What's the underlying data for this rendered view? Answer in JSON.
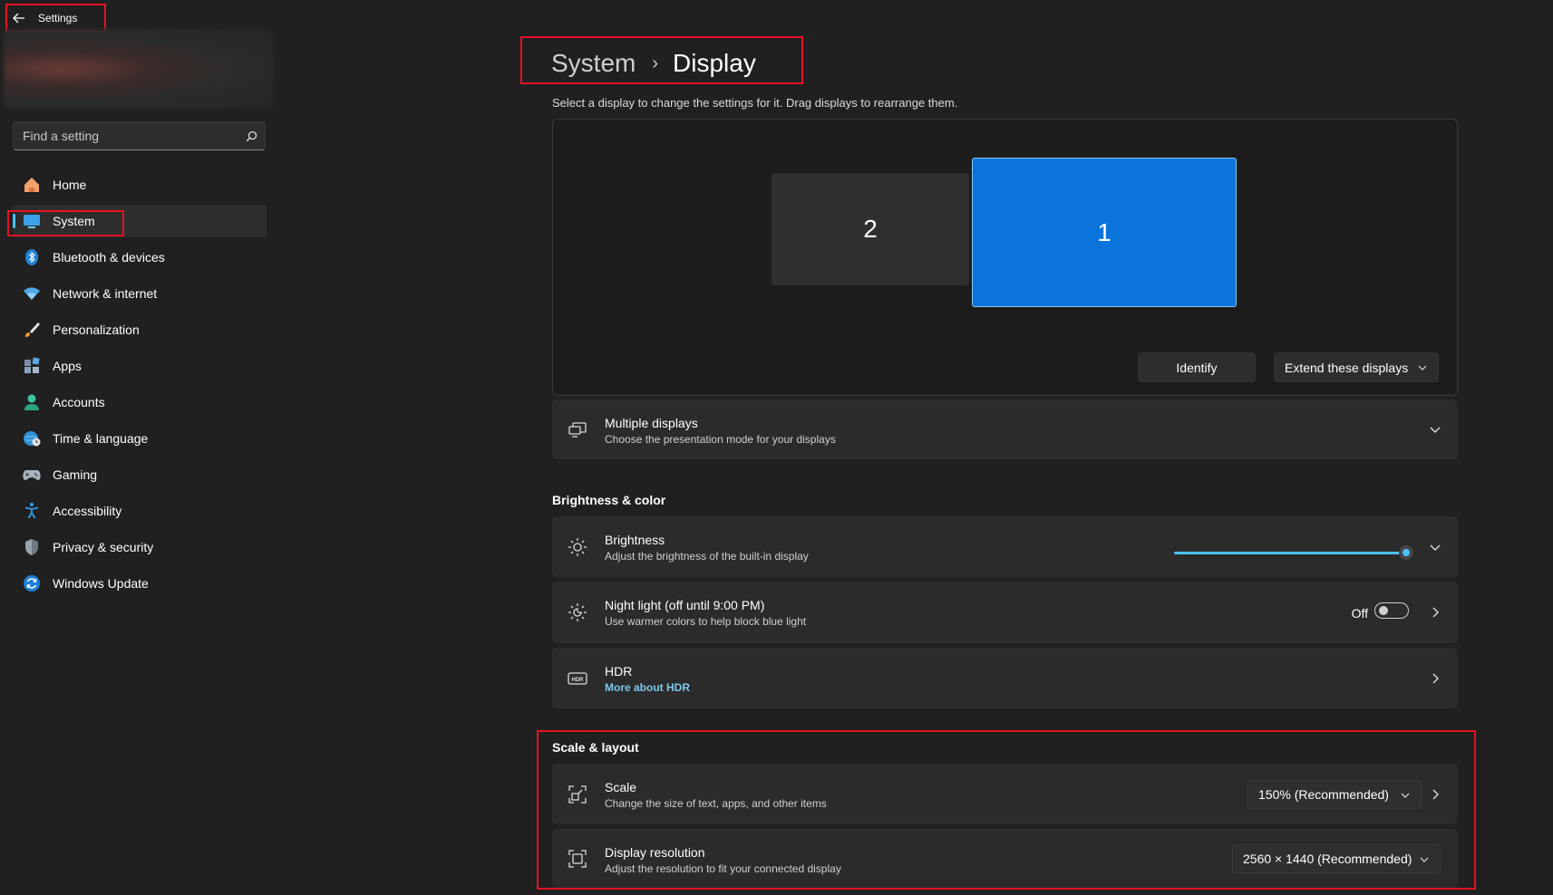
{
  "app": {
    "title": "Settings"
  },
  "search": {
    "placeholder": "Find a setting"
  },
  "sidebar": {
    "items": [
      {
        "label": "Home",
        "icon": "home-icon",
        "active": false
      },
      {
        "label": "System",
        "icon": "monitor-icon",
        "active": true
      },
      {
        "label": "Bluetooth & devices",
        "icon": "bluetooth-icon",
        "active": false
      },
      {
        "label": "Network & internet",
        "icon": "wifi-icon",
        "active": false
      },
      {
        "label": "Personalization",
        "icon": "brush-icon",
        "active": false
      },
      {
        "label": "Apps",
        "icon": "apps-icon",
        "active": false
      },
      {
        "label": "Accounts",
        "icon": "person-icon",
        "active": false
      },
      {
        "label": "Time & language",
        "icon": "globe-clock-icon",
        "active": false
      },
      {
        "label": "Gaming",
        "icon": "gamepad-icon",
        "active": false
      },
      {
        "label": "Accessibility",
        "icon": "accessibility-icon",
        "active": false
      },
      {
        "label": "Privacy & security",
        "icon": "shield-icon",
        "active": false
      },
      {
        "label": "Windows Update",
        "icon": "refresh-icon",
        "active": false
      }
    ]
  },
  "header": {
    "crumb_parent": "System",
    "crumb_separator": "›",
    "crumb_current": "Display",
    "subtitle": "Select a display to change the settings for it. Drag displays to rearrange them."
  },
  "arrangement": {
    "monitor_2": "2",
    "monitor_1": "1",
    "identify_label": "Identify",
    "mode_value": "Extend these displays"
  },
  "multiple_displays": {
    "title": "Multiple displays",
    "subtitle": "Choose the presentation mode for your displays"
  },
  "brightness_color": {
    "heading": "Brightness & color",
    "brightness": {
      "title": "Brightness",
      "subtitle": "Adjust the brightness of the built-in display",
      "value": 100
    },
    "night_light": {
      "title": "Night light (off until 9:00 PM)",
      "subtitle": "Use warmer colors to help block blue light",
      "state": "Off"
    },
    "hdr": {
      "title": "HDR",
      "link": "More about HDR"
    }
  },
  "scale_layout": {
    "heading": "Scale & layout",
    "scale": {
      "title": "Scale",
      "subtitle": "Change the size of text, apps, and other items",
      "value": "150% (Recommended)"
    },
    "resolution": {
      "title": "Display resolution",
      "subtitle": "Adjust the resolution to fit your connected display",
      "value": "2560 × 1440 (Recommended)"
    }
  },
  "colors": {
    "accent": "#0a74da",
    "link": "#7dc7ee",
    "highlight": "#e81123",
    "background": "#202020",
    "card": "#2b2b2b"
  }
}
